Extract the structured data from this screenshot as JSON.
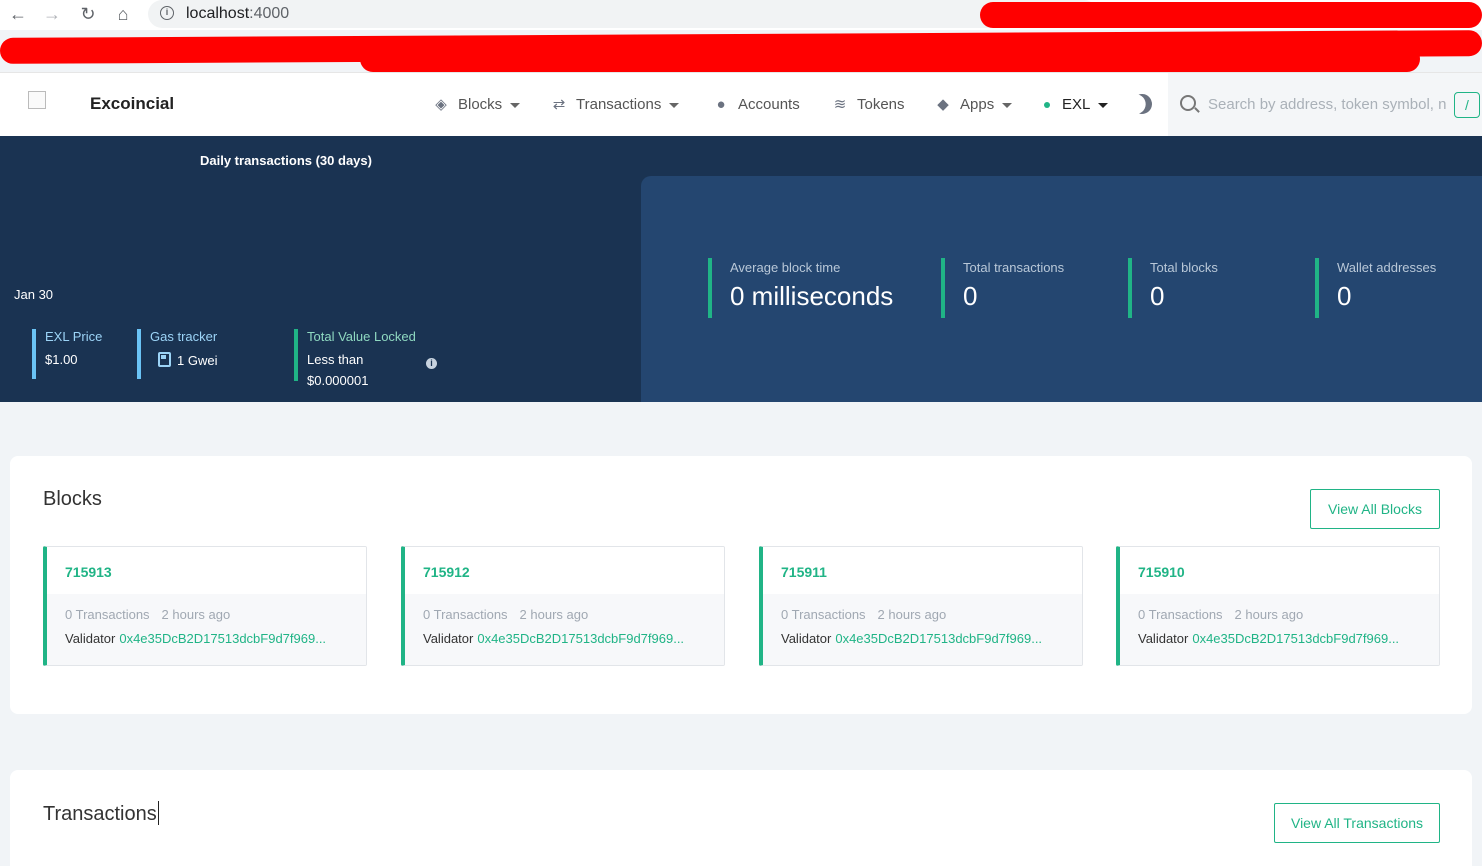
{
  "browser": {
    "url_host": "localhost",
    "url_port": ":4000"
  },
  "header": {
    "brand": "Excoincial",
    "menu": [
      {
        "label": "Blocks",
        "icon": "cube-icon"
      },
      {
        "label": "Transactions",
        "icon": "arrows-icon"
      },
      {
        "label": "Accounts",
        "icon": "user-icon"
      },
      {
        "label": "Tokens",
        "icon": "coins-icon"
      },
      {
        "label": "Apps",
        "icon": "layers-icon"
      },
      {
        "label": "EXL",
        "icon": "network-dot"
      }
    ],
    "search_placeholder": "Search by address, token symbol, name, transaction hash, or block number",
    "search_shortcut": "/"
  },
  "dashboard": {
    "chart_title": "Daily transactions (30 days)",
    "chart_date": "Jan 30",
    "price": {
      "label": "EXL Price",
      "value": "$1.00"
    },
    "gas": {
      "label": "Gas tracker",
      "value": "1 Gwei"
    },
    "tvl": {
      "label": "Total Value Locked",
      "value_line1": "Less than",
      "value_line2": "$0.000001"
    },
    "stats": [
      {
        "label": "Average block time",
        "value": "0 milliseconds"
      },
      {
        "label": "Total transactions",
        "value": "0"
      },
      {
        "label": "Total blocks",
        "value": "0"
      },
      {
        "label": "Wallet addresses",
        "value": "0"
      }
    ]
  },
  "blocks_section": {
    "title": "Blocks",
    "view_all": "View All Blocks",
    "tiles": [
      {
        "number": "715913",
        "tx_count": "0 Transactions",
        "age": "2 hours ago",
        "validator_label": "Validator",
        "validator": "0x4e35DcB2D17513dcbF9d7f969..."
      },
      {
        "number": "715912",
        "tx_count": "0 Transactions",
        "age": "2 hours ago",
        "validator_label": "Validator",
        "validator": "0x4e35DcB2D17513dcbF9d7f969..."
      },
      {
        "number": "715911",
        "tx_count": "0 Transactions",
        "age": "2 hours ago",
        "validator_label": "Validator",
        "validator": "0x4e35DcB2D17513dcbF9d7f969..."
      },
      {
        "number": "715910",
        "tx_count": "0 Transactions",
        "age": "2 hours ago",
        "validator_label": "Validator",
        "validator": "0x4e35DcB2D17513dcbF9d7f969..."
      }
    ]
  },
  "transactions_section": {
    "title": "Transactions",
    "view_all": "View All Transactions"
  },
  "colors": {
    "accent": "#20b486",
    "dashboard_bg": "#1a3352",
    "stats_panel_bg": "#244670",
    "redaction": "#ff0000"
  }
}
